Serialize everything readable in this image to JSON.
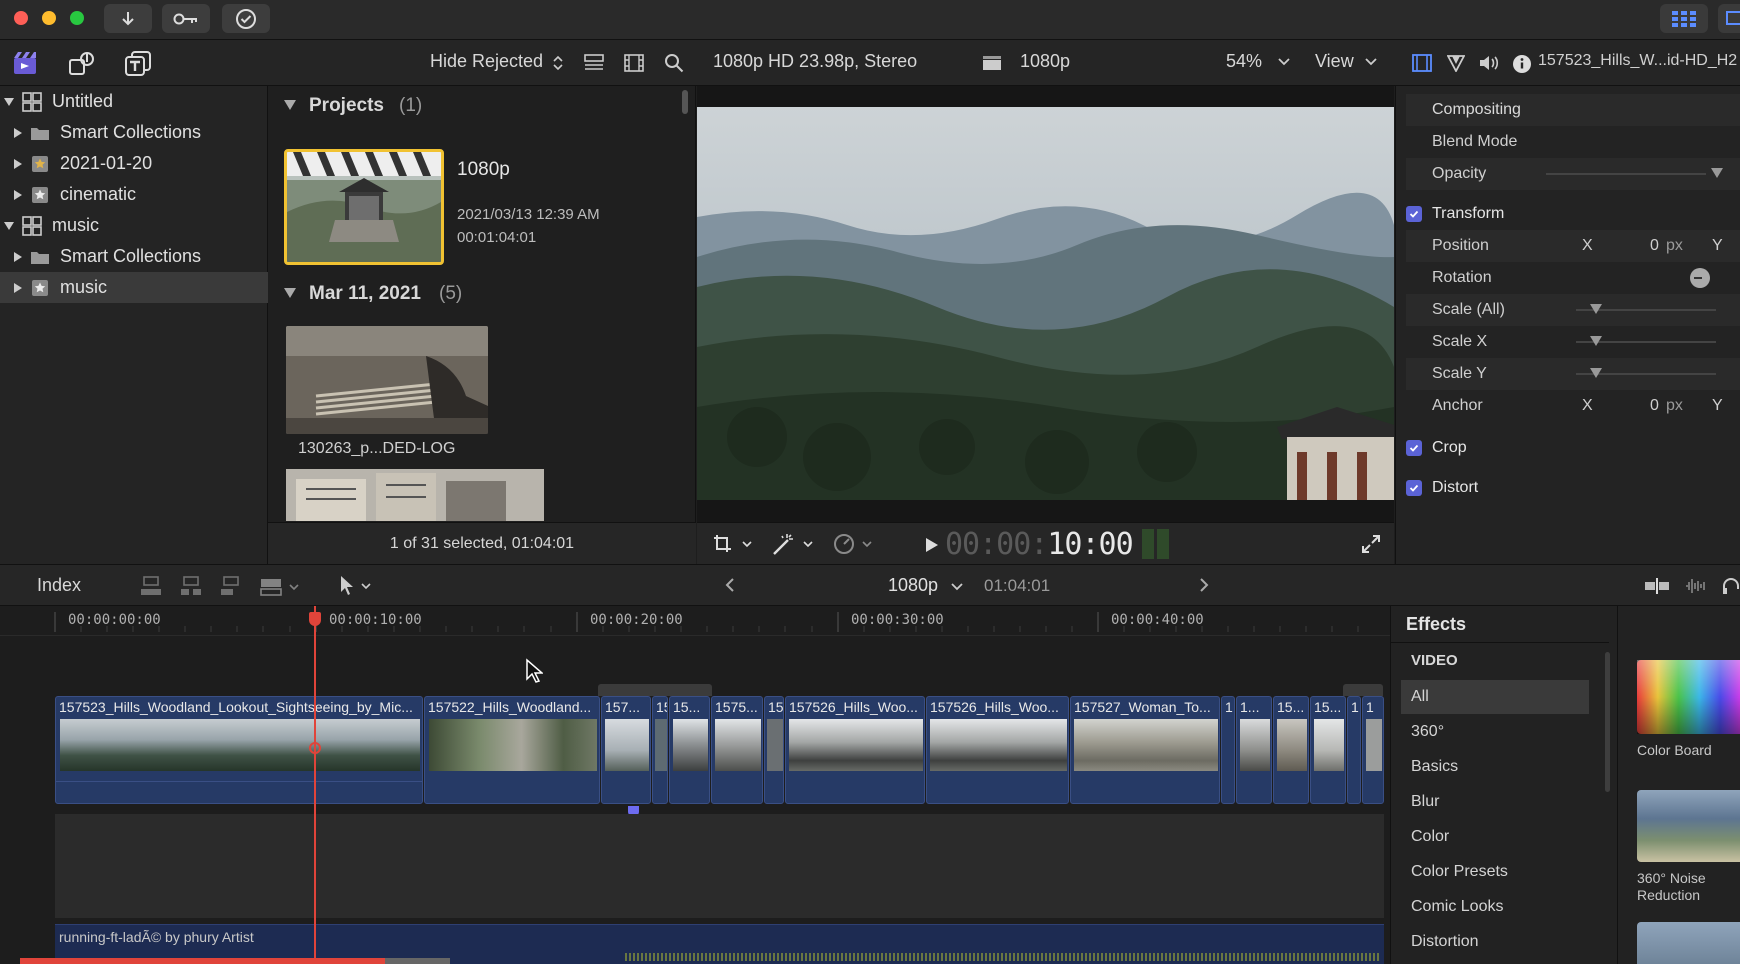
{
  "toolbar": {
    "hide_rejected": "Hide Rejected",
    "viewer_format": "1080p HD 23.98p, Stereo",
    "project_name": "1080p",
    "zoom": "54%",
    "view_label": "View",
    "inspector_title": "157523_Hills_W...id-HD_H2"
  },
  "sidebar": {
    "items": [
      {
        "label": "Untitled"
      },
      {
        "label": "Smart Collections"
      },
      {
        "label": "2021-01-20"
      },
      {
        "label": "cinematic"
      },
      {
        "label": "music"
      },
      {
        "label": "Smart Collections"
      },
      {
        "label": "music"
      }
    ]
  },
  "browser": {
    "projects_header": "Projects",
    "projects_count": "(1)",
    "project": {
      "name": "1080p",
      "date": "2021/03/13 12:39 AM",
      "duration": "00:01:04:01"
    },
    "date_header": "Mar 11, 2021",
    "date_count": "(5)",
    "clip1_name": "130263_p...DED-LOG",
    "footer": "1 of 31 selected, 01:04:01"
  },
  "viewer": {
    "timecode_dim": "00:00:",
    "timecode": "10:00"
  },
  "inspector": {
    "compositing": "Compositing",
    "blend_mode": "Blend Mode",
    "opacity": "Opacity",
    "transform": "Transform",
    "position": "Position",
    "x_label": "X",
    "y_label": "Y",
    "pos_x": "0",
    "px": "px",
    "rotation": "Rotation",
    "scale_all": "Scale (All)",
    "scale_x": "Scale X",
    "scale_y": "Scale Y",
    "anchor": "Anchor",
    "anchor_x": "0",
    "crop": "Crop",
    "distort": "Distort"
  },
  "timeline_toolbar": {
    "index": "Index",
    "project": "1080p",
    "duration": "01:04:01"
  },
  "timeline": {
    "ruler": [
      "00:00:00:00",
      "00:00:10:00",
      "00:00:20:00",
      "00:00:30:00",
      "00:00:40:00"
    ],
    "clips": [
      "157523_Hills_Woodland_Lookout_Sightseeing_by_Mic...",
      "157522_Hills_Woodland...",
      "157...",
      "15",
      "15...",
      "1575...",
      "15",
      "157526_Hills_Woo...",
      "157526_Hills_Woo...",
      "157527_Woman_To...",
      "1",
      "1...",
      "15...",
      "15...",
      "1",
      "1"
    ],
    "audio_label": "running-ft-ladÃ© by phury Artist"
  },
  "effects": {
    "title": "Effects",
    "section": "VIDEO",
    "categories": [
      "All",
      "360°",
      "Basics",
      "Blur",
      "Color",
      "Color Presets",
      "Comic Looks",
      "Distortion"
    ],
    "tiles": [
      "Color Board",
      "360° Noise Reduction"
    ]
  },
  "colors": {
    "accent": "#5b63d6",
    "clip": "#263a66",
    "playhead": "#e0443a"
  }
}
